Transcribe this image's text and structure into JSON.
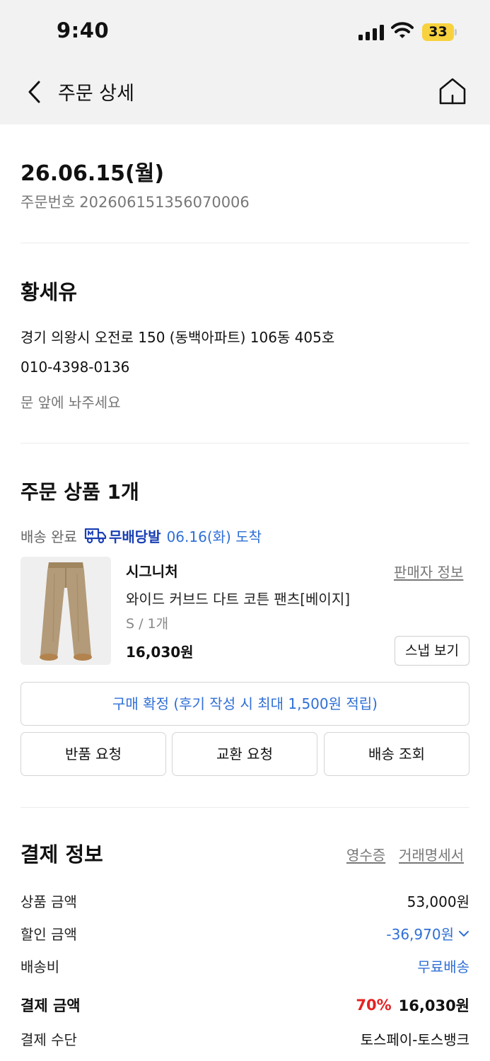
{
  "status_bar": {
    "time": "9:40",
    "battery": "33"
  },
  "header": {
    "title": "주문 상세"
  },
  "order": {
    "date": "26.06.15(월)",
    "number_label": "주문번호",
    "number": "202606151356070006"
  },
  "delivery": {
    "recipient": "황세유",
    "address": "경기 의왕시 오전로 150 (동백아파트) 106동 405호",
    "phone": "010-4398-0136",
    "memo": "문 앞에 놔주세요"
  },
  "items_section": {
    "title": "주문 상품 1개",
    "ship_status": "배송 완료",
    "ship_badge": "무배당발",
    "arrival": "06.16(화) 도착"
  },
  "product": {
    "brand": "시그니처",
    "seller_info": "판매자 정보",
    "name": "와이드 커브드 다트 코튼 팬츠[베이지]",
    "option": "S / 1개",
    "price": "16,030원",
    "snap_button": "스냅 보기"
  },
  "actions": {
    "confirm": "구매 확정 (후기 작성 시 최대 1,500원 적립)",
    "return": "반품 요청",
    "exchange": "교환 요청",
    "tracking": "배송 조회"
  },
  "payment": {
    "title": "결제 정보",
    "receipt": "영수증",
    "invoice": "거래명세서",
    "rows": [
      {
        "label": "상품 금액",
        "value": "53,000원"
      },
      {
        "label": "할인 금액",
        "value": "-36,970원"
      },
      {
        "label": "배송비",
        "value": "무료배송"
      },
      {
        "label": "결제 금액",
        "rate": "70%",
        "value": "16,030원"
      },
      {
        "label": "결제 수단",
        "value": "토스페이-토스뱅크"
      }
    ]
  },
  "colors": {
    "link_blue": "#2f6fd6",
    "badge_navy": "#1a3fb4",
    "discount_red": "#e52222",
    "battery_yellow": "#f7d23e",
    "header_bg": "#f2f2f2"
  },
  "icons": [
    "back-arrow-icon",
    "home-icon",
    "mubae-delivery-icon",
    "chevron-down-icon",
    "cellular-signal-icon",
    "wifi-icon",
    "battery-icon"
  ]
}
